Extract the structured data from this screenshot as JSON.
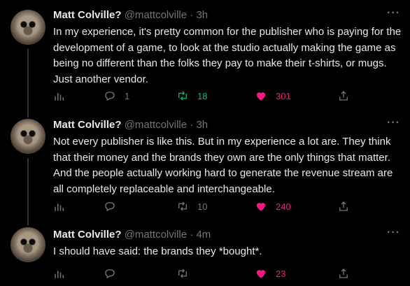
{
  "tweets": [
    {
      "name": "Matt Colville?",
      "handle": "@mattcolville",
      "time": "3h",
      "text": "In my experience, it's pretty common for the publisher who is paying for the development of a game, to look at the studio actually making the game as being no different than the folks they pay to make their t-shirts, or mugs. Just another vendor.",
      "replies": "1",
      "retweets": "18",
      "likes": "301"
    },
    {
      "name": "Matt Colville?",
      "handle": "@mattcolville",
      "time": "3h",
      "text": "Not every publisher is like this. But in my experience a lot are. They think that their money and the brands they own are the only things that matter. And the people actually working hard to generate the revenue stream are all completely replaceable and interchangeable.",
      "replies": "",
      "retweets": "10",
      "likes": "240"
    },
    {
      "name": "Matt Colville?",
      "handle": "@mattcolville",
      "time": "4m",
      "text": "I should have said: the brands they *bought*.",
      "replies": "",
      "retweets": "",
      "likes": "23"
    }
  ],
  "separator": "·",
  "icons": [
    "analytics-icon",
    "reply-icon",
    "retweet-icon",
    "heart-icon",
    "share-icon",
    "more-icon"
  ],
  "colors": {
    "background": "#000000",
    "text": "#e7e9ea",
    "muted": "#71767b",
    "retweet": "#00ba7c",
    "like": "#f91880"
  }
}
